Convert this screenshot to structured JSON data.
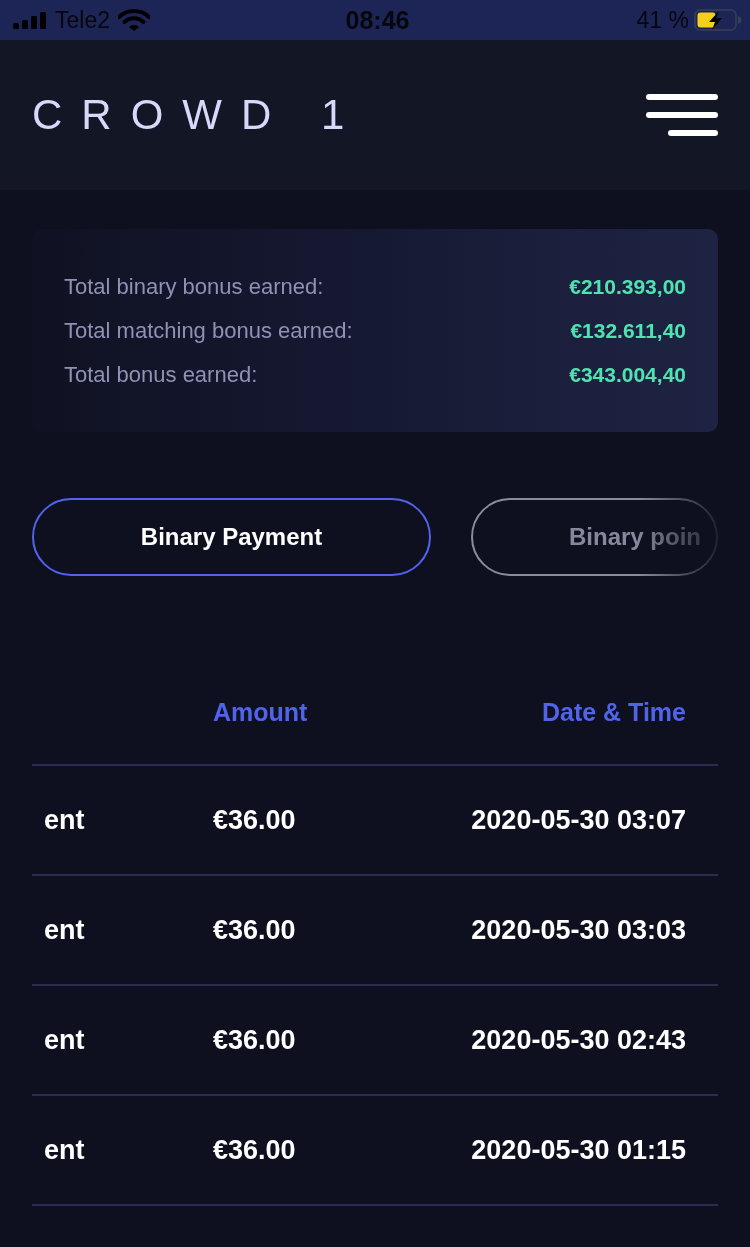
{
  "status_bar": {
    "carrier": "Tele2",
    "time": "08:46",
    "battery": "41 %"
  },
  "header": {
    "logo": "CROWD 1"
  },
  "summary": [
    {
      "label": "Total binary bonus earned:",
      "value": "€210.393,00"
    },
    {
      "label": "Total matching bonus earned:",
      "value": "€132.611,40"
    },
    {
      "label": "Total bonus earned:",
      "value": "€343.004,40"
    }
  ],
  "tabs": [
    {
      "label": "Binary Payment",
      "selected": true
    },
    {
      "label": "Binary poin",
      "selected": false
    }
  ],
  "table": {
    "columns": [
      "Amount",
      "Date & Time"
    ],
    "rows": [
      {
        "column_1": "ent",
        "amount": "€36.00",
        "date_time": "2020-05-30 03:07"
      },
      {
        "column_1": "ent",
        "amount": "€36.00",
        "date_time": "2020-05-30 03:03"
      },
      {
        "column_1": "ent",
        "amount": "€36.00",
        "date_time": "2020-05-30 02:43"
      },
      {
        "column_1": "ent",
        "amount": "€36.00",
        "date_time": "2020-05-30 01:15"
      }
    ]
  }
}
